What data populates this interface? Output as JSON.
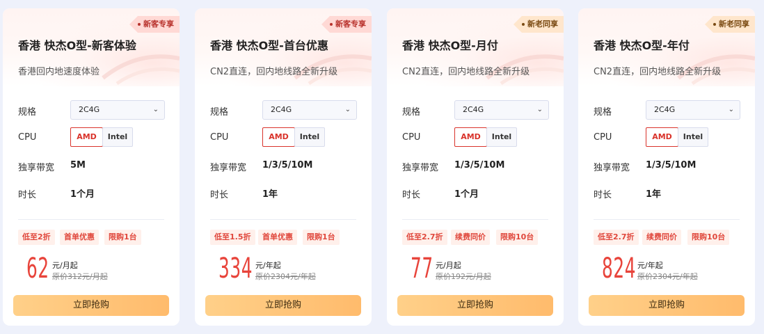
{
  "labels": {
    "spec": "规格",
    "cpu": "CPU",
    "bandwidth": "独享带宽",
    "duration": "时长",
    "buy": "立即抢购"
  },
  "colors": {
    "accent": "#d9332b",
    "price": "#e8443b",
    "button_from": "#ffd089",
    "button_to": "#ffbb6c"
  },
  "cards": [
    {
      "tag": "新客专享",
      "tag_style": "new",
      "title": "香港 快杰O型-新客体验",
      "subtitle": "香港回内地速度体验",
      "spec": "2C4G",
      "cpu_options": [
        "AMD",
        "Intel"
      ],
      "cpu_selected": "AMD",
      "bandwidth": "5M",
      "duration": "1个月",
      "badges": [
        "低至2折",
        "首单优惠",
        "限购1台"
      ],
      "price": "62",
      "unit": "元/月起",
      "original": "原价312元/月起"
    },
    {
      "tag": "新客专享",
      "tag_style": "new",
      "title": "香港 快杰O型-首台优惠",
      "subtitle": "CN2直连，回内地线路全新升级",
      "spec": "2C4G",
      "cpu_options": [
        "AMD",
        "Intel"
      ],
      "cpu_selected": "AMD",
      "bandwidth": "1/3/5/10M",
      "duration": "1年",
      "badges": [
        "低至1.5折",
        "首单优惠",
        "限购1台"
      ],
      "price": "334",
      "unit": "元/年起",
      "original": "原价2304元/年起"
    },
    {
      "tag": "新老同享",
      "tag_style": "old",
      "title": "香港 快杰O型-月付",
      "subtitle": "CN2直连，回内地线路全新升级",
      "spec": "2C4G",
      "cpu_options": [
        "AMD",
        "Intel"
      ],
      "cpu_selected": "AMD",
      "bandwidth": "1/3/5/10M",
      "duration": "1个月",
      "badges": [
        "低至2.7折",
        "续费同价",
        "限购10台"
      ],
      "price": "77",
      "unit": "元/月起",
      "original": "原价192元/月起"
    },
    {
      "tag": "新老同享",
      "tag_style": "old",
      "title": "香港 快杰O型-年付",
      "subtitle": "CN2直连，回内地线路全新升级",
      "spec": "2C4G",
      "cpu_options": [
        "AMD",
        "Intel"
      ],
      "cpu_selected": "AMD",
      "bandwidth": "1/3/5/10M",
      "duration": "1年",
      "badges": [
        "低至2.7折",
        "续费同价",
        "限购10台"
      ],
      "price": "824",
      "unit": "元/年起",
      "original": "原价2304元/年起"
    }
  ]
}
